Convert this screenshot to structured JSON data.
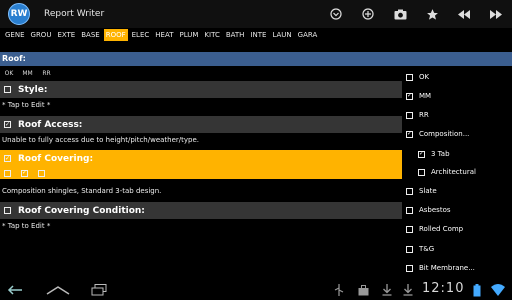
{
  "app": {
    "title": "Report Writer",
    "icon_text": "RW"
  },
  "toolbar": {
    "icons": [
      "dropdown-icon",
      "add-icon",
      "camera-icon",
      "star-icon",
      "rewind-icon",
      "fast-forward-icon"
    ]
  },
  "tabs": [
    {
      "label": "GENE",
      "active": false
    },
    {
      "label": "GROU",
      "active": false
    },
    {
      "label": "EXTE",
      "active": false
    },
    {
      "label": "BASE",
      "active": false
    },
    {
      "label": "ROOF",
      "active": true
    },
    {
      "label": "ELEC",
      "active": false
    },
    {
      "label": "HEAT",
      "active": false
    },
    {
      "label": "PLUM",
      "active": false
    },
    {
      "label": "KITC",
      "active": false
    },
    {
      "label": "BATH",
      "active": false
    },
    {
      "label": "INTE",
      "active": false
    },
    {
      "label": "LAUN",
      "active": false
    },
    {
      "label": "GARA",
      "active": false
    }
  ],
  "section": {
    "title": "Roof:"
  },
  "columns": [
    "OK",
    "MM",
    "RR"
  ],
  "items": [
    {
      "title": "Style:",
      "checked": false,
      "text": "* Tap to Edit *"
    },
    {
      "title": "Roof Access:",
      "checked": true,
      "text": "Unable to fully access due to height/pitch/weather/type."
    },
    {
      "title": "Roof Covering:",
      "checked": true,
      "highlight": true,
      "row_checks": [
        false,
        true,
        false
      ],
      "text": "Composition shingles, Standard 3-tab design."
    },
    {
      "title": "Roof Covering Condition:",
      "checked": false,
      "text": "* Tap to Edit *"
    }
  ],
  "options": [
    {
      "label": "OK",
      "checked": false,
      "indent": false
    },
    {
      "label": "MM",
      "checked": true,
      "indent": false
    },
    {
      "label": "RR",
      "checked": false,
      "indent": false
    },
    {
      "label": "Composition...",
      "checked": true,
      "indent": false
    },
    {
      "label": "3 Tab",
      "checked": true,
      "indent": true
    },
    {
      "label": "Architectural",
      "checked": false,
      "indent": true
    },
    {
      "label": "Slate",
      "checked": false,
      "indent": false
    },
    {
      "label": "Asbestos",
      "checked": false,
      "indent": false
    },
    {
      "label": "Rolled Comp",
      "checked": false,
      "indent": false
    },
    {
      "label": "T&G",
      "checked": false,
      "indent": false
    },
    {
      "label": "Bit Membrane...",
      "checked": false,
      "indent": false
    }
  ],
  "system": {
    "time": "12:10"
  },
  "colors": {
    "accent": "#ffb300",
    "section_header": "#3b5e8f",
    "item_header": "#353535"
  }
}
